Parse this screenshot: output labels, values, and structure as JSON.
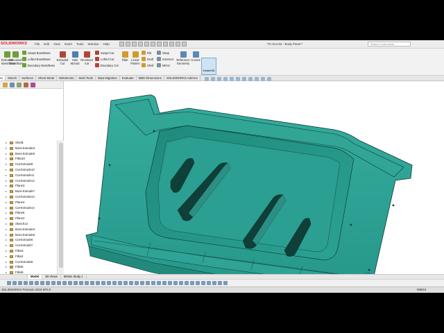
{
  "app": {
    "logo": "SOLIDWORKS",
    "document_title": "TC-014-02 - Body Panel *",
    "search_placeholder": "Search Commands"
  },
  "menus": [
    "File",
    "Edit",
    "View",
    "Insert",
    "Tools",
    "Window",
    "Help"
  ],
  "command_manager": {
    "large": [
      {
        "label": "Extruded\nBoss/Base",
        "color": "#6e9f3a"
      },
      {
        "label": "Revolved\nBoss/Base",
        "color": "#6e9f3a"
      },
      {
        "label": "Extruded\nCut",
        "color": "#b0443a"
      },
      {
        "label": "Hole\nWizard",
        "color": "#4c7fb3"
      },
      {
        "label": "Revolved\nCut",
        "color": "#b0443a"
      },
      {
        "label": "Fillet",
        "color": "#d29a2a"
      },
      {
        "label": "Linear\nPattern",
        "color": "#d29a2a"
      },
      {
        "label": "Reference\nGeometry",
        "color": "#5a88b5"
      },
      {
        "label": "Curves",
        "color": "#5a88b5"
      },
      {
        "label": "Instant3D",
        "color": "#5a88b5"
      }
    ],
    "boss_group": [
      "Swept Boss/Base",
      "Lofted Boss/Base",
      "Boundary Boss/Base"
    ],
    "cut_group": [
      "Swept Cut",
      "Lofted Cut",
      "Boundary Cut"
    ],
    "feature_group": [
      "Rib",
      "Draft",
      "Shell"
    ],
    "wrap_group": [
      "Wrap",
      "Intersect",
      "Mirror"
    ]
  },
  "tabs": [
    "Features",
    "Sketch",
    "Surfaces",
    "Sheet Metal",
    "Weldments",
    "Mold Tools",
    "Data Migration",
    "Evaluate",
    "MBD Dimensions",
    "SOLIDWORKS Add-Ins"
  ],
  "active_tab": "Features",
  "tree": [
    "Shell1",
    "Boss-Extrude3",
    "Boss-Extrude6",
    "Fillet10",
    "Cut-Extrude9",
    "Cut-Extrude10",
    "Cut-Extrude11",
    "Cut-Extrude12",
    "Plane3",
    "Boss-Extrude7",
    "Cut-Extrude13",
    "Plane4",
    "Cut-Extrude14",
    "Plane5",
    "Plane2",
    "Sketch13",
    "Boss-Extrude4",
    "Boss-Extrude5",
    "Cut-Extrude6",
    "Cut-Extrude7",
    "Fillet3",
    "Fillet4",
    "Cut-Extrude8",
    "Fillet5",
    "Fillet6",
    "Fillet7",
    "Fillet8",
    "Boss-Extrude9",
    "Fillet11",
    "Fillet12",
    "Cut-Extrude17",
    "Fillet13",
    "Boss-Extrude10"
  ],
  "bottom_tabs": [
    "",
    "Model",
    "3D Views",
    "Motion Study 1"
  ],
  "active_bottom_tab": "Model",
  "status": {
    "left": "SOLIDWORKS Premium 2018 SP2.0",
    "units": "MMGS"
  },
  "colors": {
    "part": "#2a9c8e",
    "part_edge": "#0e3a35",
    "part_dark": "#1d7e72",
    "part_light": "#39b0a1"
  }
}
